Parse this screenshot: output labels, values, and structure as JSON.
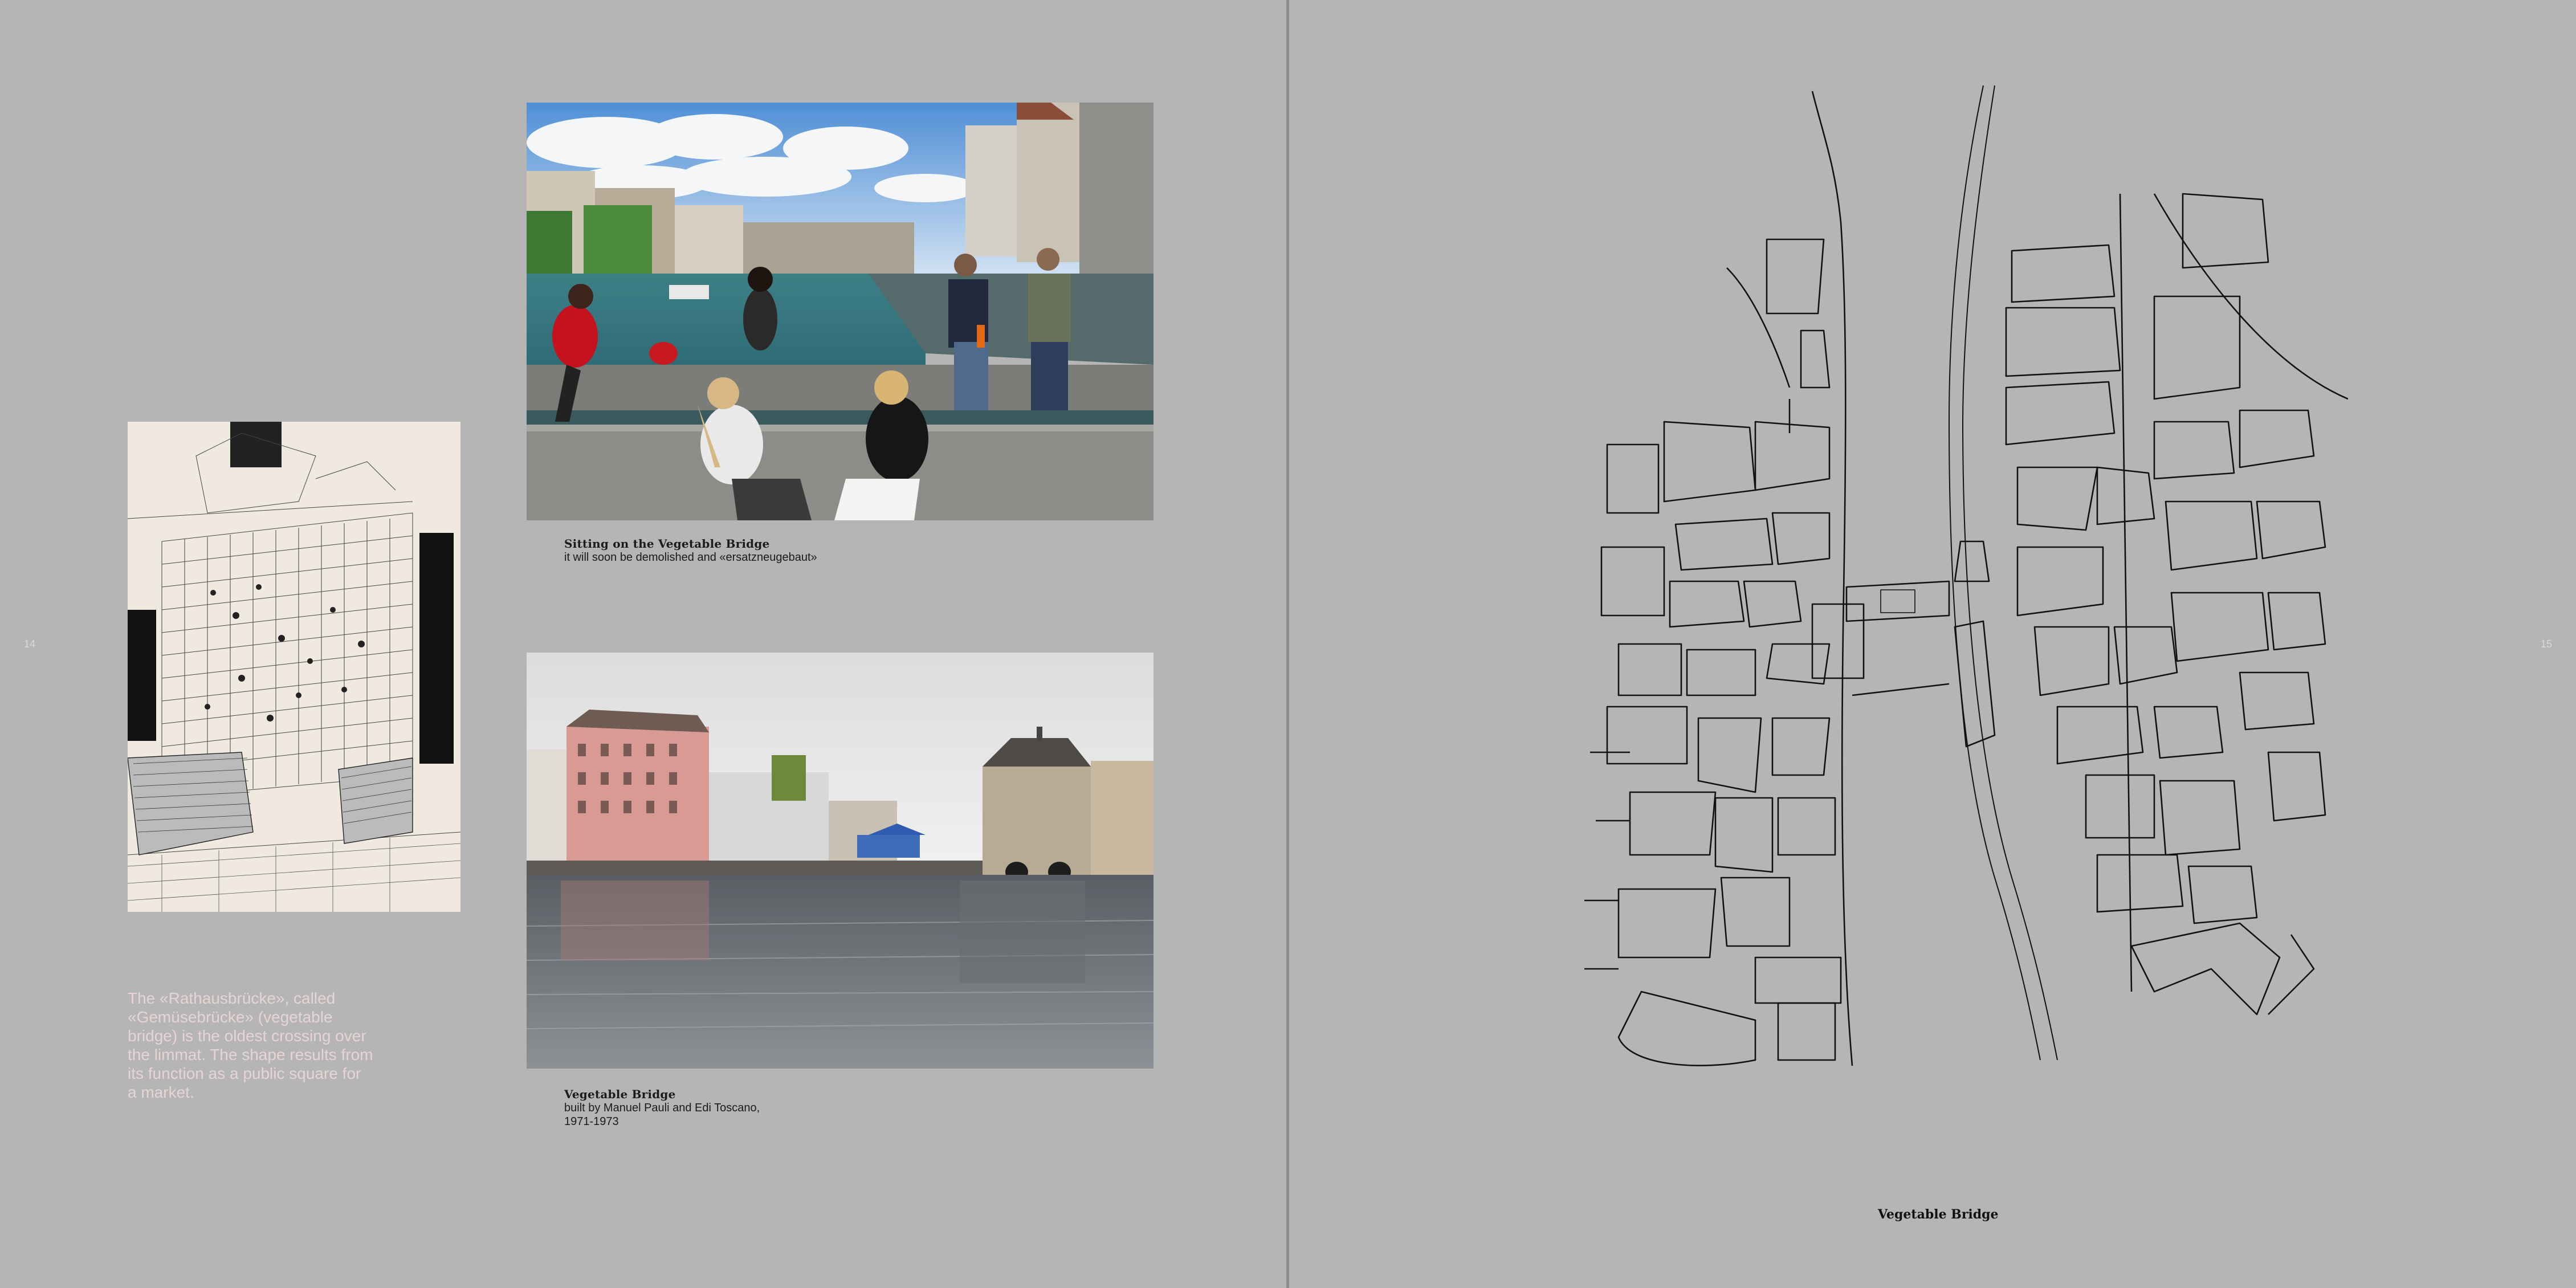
{
  "spread": {
    "left_page_number": "14",
    "right_page_number": "15"
  },
  "left_page": {
    "intro_text_lines": [
      "The «Rathausbrücke», called",
      "«Gemüsebrücke» (vegetable",
      "bridge) is the oldest crossing over",
      "the limmat. The shape results from",
      "its function as a public square for",
      "a market."
    ],
    "photo_top": {
      "caption_title": "Sitting on the Vegetable Bridge",
      "caption_text": "it will soon be demolished and «ersatzneugebaut»"
    },
    "photo_bottom": {
      "caption_title": "Vegetable Bridge",
      "caption_line1": "built by Manuel Pauli and Edi Toscano,",
      "caption_line2": "1971-1973"
    }
  },
  "right_page": {
    "map_title": "Vegetable Bridge"
  },
  "colors": {
    "page_background": "#b5b5b5",
    "gutter": "#8c8c8c",
    "intro_text": "#e7d4d4",
    "caption_text": "#1b1b1b"
  }
}
